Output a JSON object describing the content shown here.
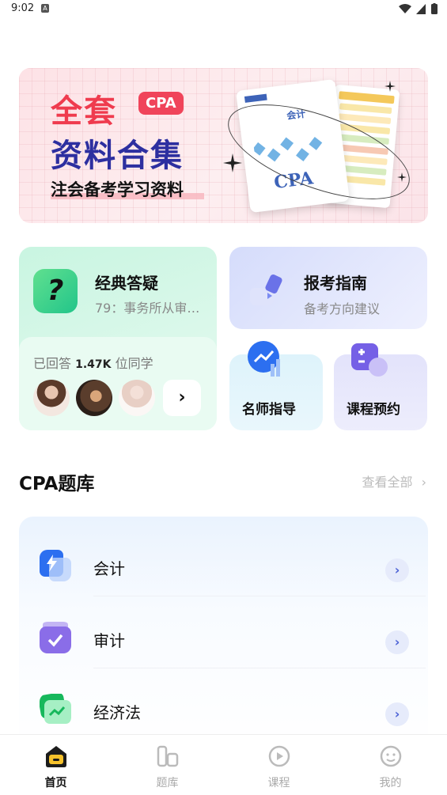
{
  "status": {
    "time": "9:02"
  },
  "banner": {
    "line1": "全套",
    "badge": "CPA",
    "line2": "资料合集",
    "line3": "注会备考学习资料",
    "book_title": "会计",
    "book_logo": "CPA"
  },
  "qa_card": {
    "title": "经典答疑",
    "subtitle": "79：事务所从审计...",
    "answered_prefix": "已回答",
    "answered_count": "1.47K",
    "answered_suffix": "位同学"
  },
  "guide_card": {
    "title": "报考指南",
    "subtitle": "备考方向建议"
  },
  "teacher_card": {
    "title": "名师指导"
  },
  "course_card": {
    "title": "课程预约"
  },
  "section": {
    "title": "CPA题库",
    "view_all": "查看全部"
  },
  "bank": {
    "items": [
      {
        "label": "会计",
        "icon": "lightning-icon"
      },
      {
        "label": "审计",
        "icon": "check-folder-icon"
      },
      {
        "label": "经济法",
        "icon": "chart-card-icon"
      }
    ]
  },
  "tabs": [
    {
      "label": "首页",
      "icon": "home-icon",
      "active": true
    },
    {
      "label": "题库",
      "icon": "question-bank-icon"
    },
    {
      "label": "课程",
      "icon": "play-icon"
    },
    {
      "label": "我的",
      "icon": "profile-icon"
    }
  ],
  "colors": {
    "accent_red": "#ef3b4e",
    "navy": "#2d2fa0",
    "green": "#22c58a",
    "blue": "#4d63d6"
  }
}
